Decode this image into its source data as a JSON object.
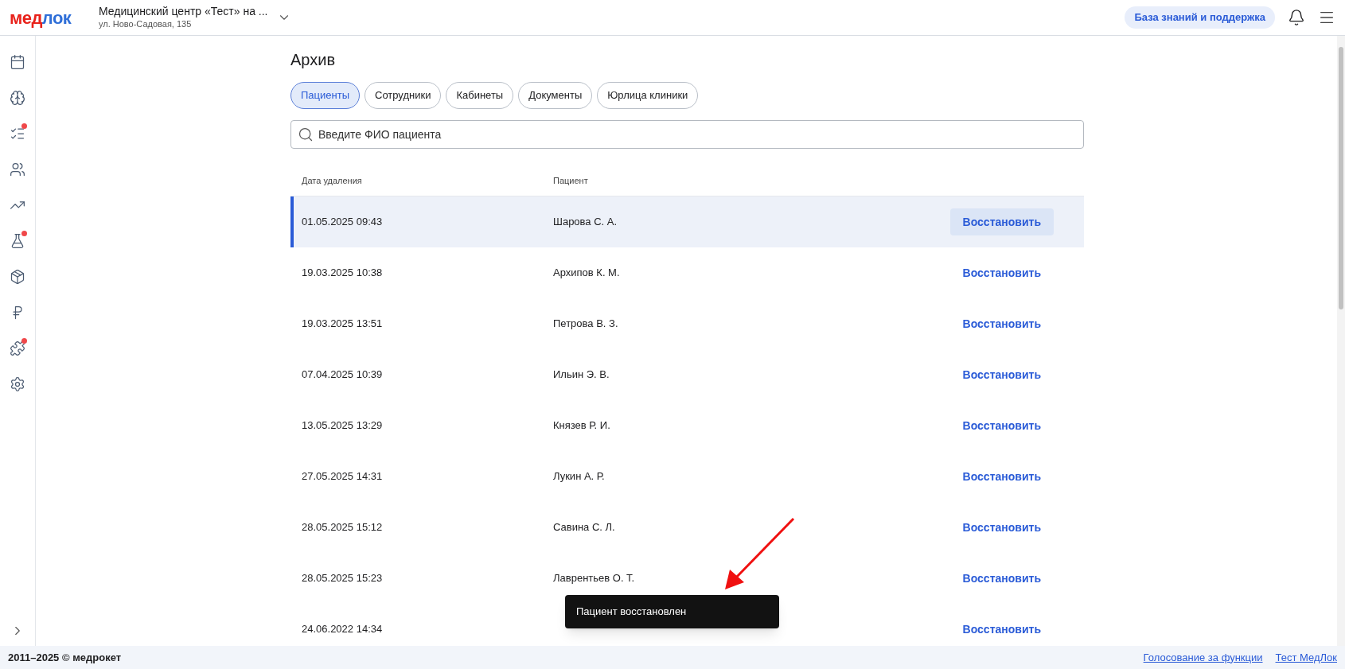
{
  "header": {
    "logo": [
      "мед",
      "лок"
    ],
    "clinic": {
      "name": "Медицинский центр «Тест» на ...",
      "address": "ул. Ново-Садовая, 135"
    },
    "support_button": "База знаний и поддержка"
  },
  "sidebar": {
    "items": [
      {
        "badge": false
      },
      {
        "badge": false
      },
      {
        "badge": true
      },
      {
        "badge": false
      },
      {
        "badge": false
      },
      {
        "badge": true
      },
      {
        "badge": false
      },
      {
        "badge": false
      },
      {
        "badge": true
      },
      {
        "badge": false
      }
    ]
  },
  "page": {
    "title": "Архив",
    "tabs": [
      {
        "label": "Пациенты",
        "selected": true
      },
      {
        "label": "Сотрудники",
        "selected": false
      },
      {
        "label": "Кабинеты",
        "selected": false
      },
      {
        "label": "Документы",
        "selected": false
      },
      {
        "label": "Юрлица клиники",
        "selected": false
      }
    ],
    "search": {
      "placeholder": "Введите ФИО пациента"
    },
    "table": {
      "columns": [
        "Дата удаления",
        "Пациент"
      ],
      "rows": [
        {
          "date": "01.05.2025 09:43",
          "patient": "Шарова С. А.",
          "action": "Восстановить",
          "selected": true
        },
        {
          "date": "19.03.2025 10:38",
          "patient": "Архипов К. М.",
          "action": "Восстановить",
          "selected": false
        },
        {
          "date": "19.03.2025 13:51",
          "patient": "Петрова В. З.",
          "action": "Восстановить",
          "selected": false
        },
        {
          "date": "07.04.2025 10:39",
          "patient": "Ильин Э. В.",
          "action": "Восстановить",
          "selected": false
        },
        {
          "date": "13.05.2025 13:29",
          "patient": "Князев Р. И.",
          "action": "Восстановить",
          "selected": false
        },
        {
          "date": "27.05.2025 14:31",
          "patient": "Лукин А. Р.",
          "action": "Восстановить",
          "selected": false
        },
        {
          "date": "28.05.2025 15:12",
          "patient": "Савина С. Л.",
          "action": "Восстановить",
          "selected": false
        },
        {
          "date": "28.05.2025 15:23",
          "patient": "Лаврентьев О. Т.",
          "action": "Восстановить",
          "selected": false
        },
        {
          "date": "24.06.2022 14:34",
          "action": "Восстановить",
          "selected": false
        }
      ]
    }
  },
  "toast": {
    "message": "Пациент восстановлен"
  },
  "footer": {
    "copyright": "2011–2025 © медрокет",
    "links": [
      "Голосование за функции",
      "Тест МедЛок"
    ]
  }
}
